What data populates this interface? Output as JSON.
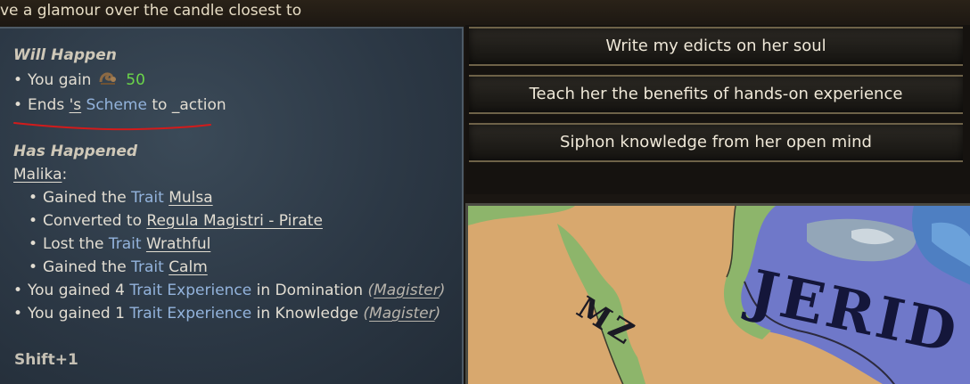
{
  "event_text": "ve a glamour over the candle closest to",
  "tooltip": {
    "will_happen_heading": "Will Happen",
    "gain_prefix": "You gain",
    "gain_value": "50",
    "ends_prefix": "Ends",
    "ends_owner": "'s",
    "ends_scheme": "Scheme",
    "ends_suffix": "to _action",
    "has_happened_heading": "Has Happened",
    "character_name": "Malika",
    "character_colon": ":",
    "effects": [
      {
        "prefix": "Gained the",
        "kind": "Trait",
        "value": "Mulsa"
      },
      {
        "prefix": "Converted to",
        "kind": "",
        "value": "Regula Magistri - Pirate"
      },
      {
        "prefix": "Lost the",
        "kind": "Trait",
        "value": "Wrathful"
      },
      {
        "prefix": "Gained the",
        "kind": "Trait",
        "value": "Calm"
      }
    ],
    "experience": [
      {
        "prefix": "You gained",
        "amount": "4",
        "kind": "Trait Experience",
        "mid": "in Domination",
        "source": "Magister"
      },
      {
        "prefix": "You gained",
        "amount": "1",
        "kind": "Trait Experience",
        "mid": "in Knowledge",
        "source": "Magister"
      }
    ],
    "shortcut": "Shift+1"
  },
  "options": [
    {
      "label": "Write my edicts on her soul"
    },
    {
      "label": "Teach her the benefits of hands-on experience"
    },
    {
      "label": "Siphon knowledge from her open mind"
    }
  ],
  "map": {
    "labels": [
      "MZ",
      "JERID"
    ]
  },
  "colors": {
    "trait_blue": "#93b3dc",
    "gain_green": "#6bd54a",
    "panel_bg": "#2c3845",
    "option_border": "#6e6248"
  }
}
